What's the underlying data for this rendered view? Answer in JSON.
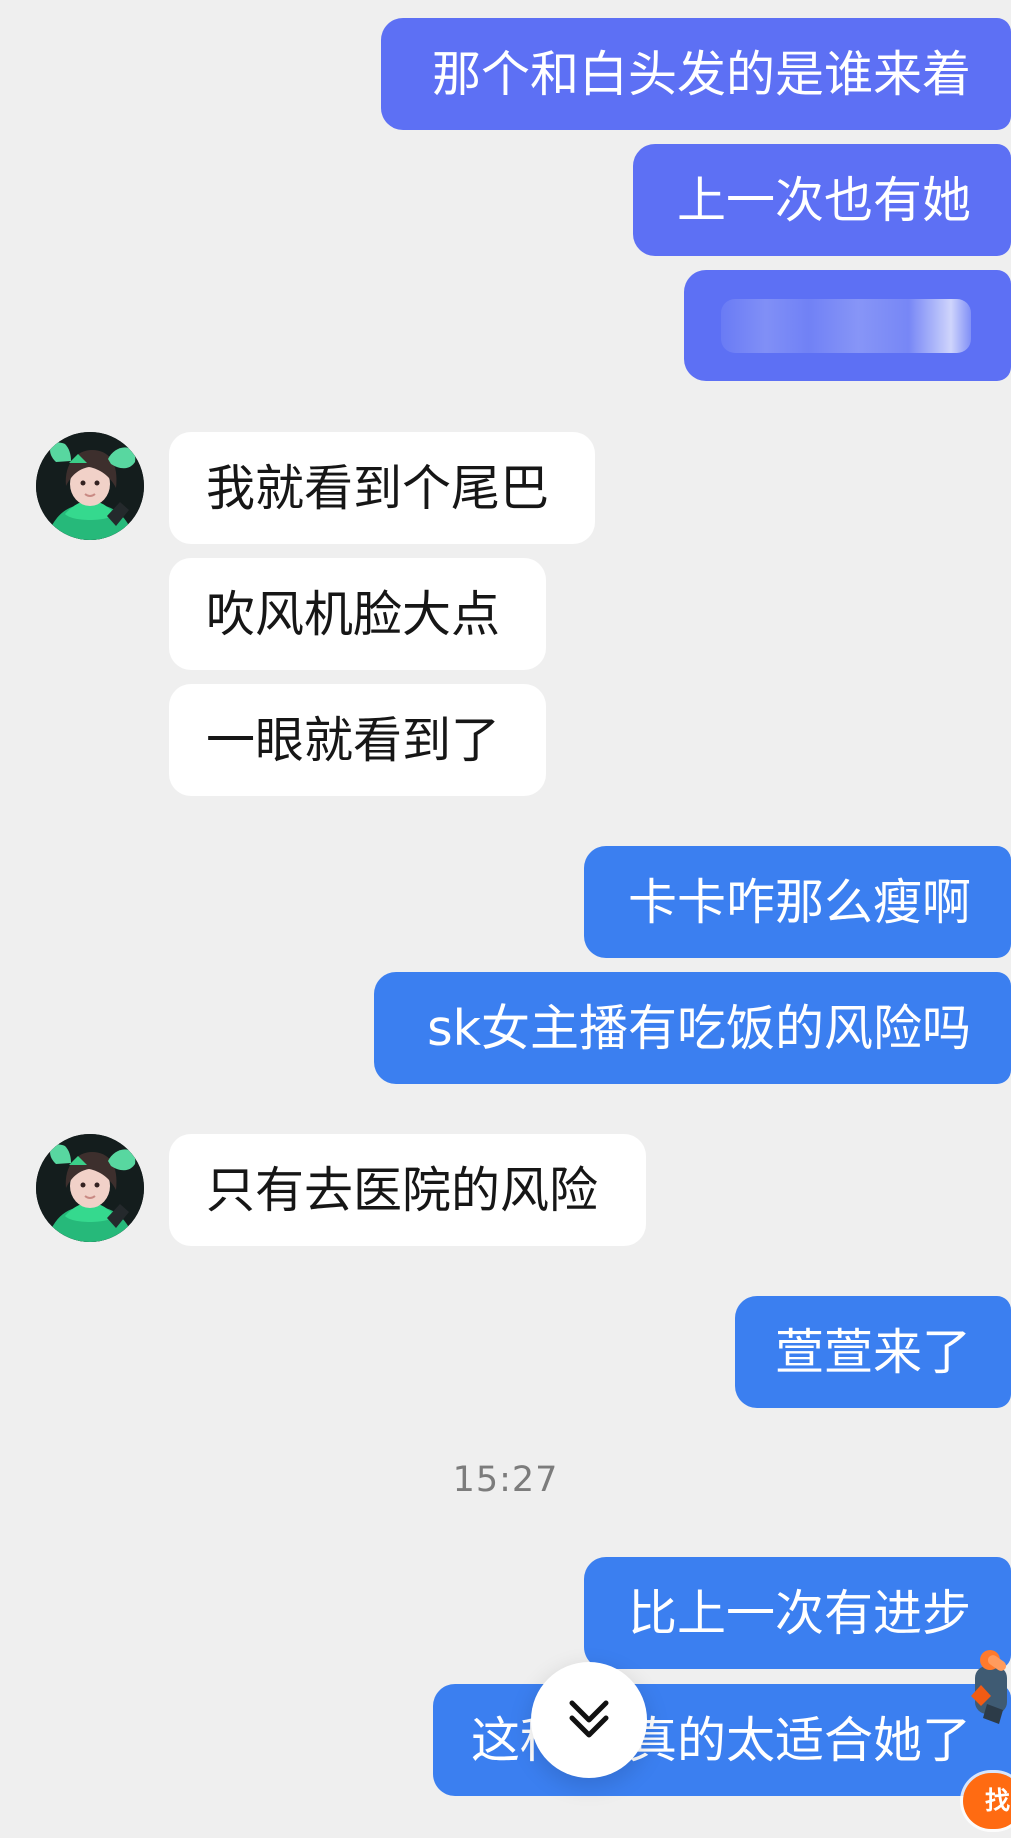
{
  "colors": {
    "background": "#efefef",
    "sent_bubble_purple": "#5d70f4",
    "sent_bubble_blue": "#3b7ff0",
    "received_bubble": "#ffffff",
    "received_text": "#161616",
    "timestamp": "#7c7c7c",
    "badge": "#ff6b12"
  },
  "messages": [
    {
      "side": "sent",
      "text": "那个和白头发的是谁来着"
    },
    {
      "side": "sent",
      "text": "上一次也有她"
    },
    {
      "side": "sent",
      "text": "",
      "blurred": true
    },
    {
      "side": "received",
      "text": "我就看到个尾巴"
    },
    {
      "side": "received",
      "text": "吹风机脸大点"
    },
    {
      "side": "received",
      "text": "一眼就看到了"
    },
    {
      "side": "sent",
      "text": "卡卡咋那么瘦啊"
    },
    {
      "side": "sent",
      "text": "sk女主播有吃饭的风险吗"
    },
    {
      "side": "received",
      "text": "只有去医院的风险"
    },
    {
      "side": "sent",
      "text": "萱萱来了"
    },
    {
      "side": "sent",
      "text": "比上一次有进步"
    },
    {
      "side": "sent",
      "text": "这种真的太适合她了"
    }
  ],
  "partial_texts": {
    "last_left": "这种",
    "last_right": "真的太适合她了"
  },
  "timestamp": "15:27",
  "icons": {
    "avatar": "contact-avatar",
    "scroll_down": "double-chevron-down-icon",
    "decoration": "mascot-icon"
  },
  "badge": {
    "label": "找"
  }
}
